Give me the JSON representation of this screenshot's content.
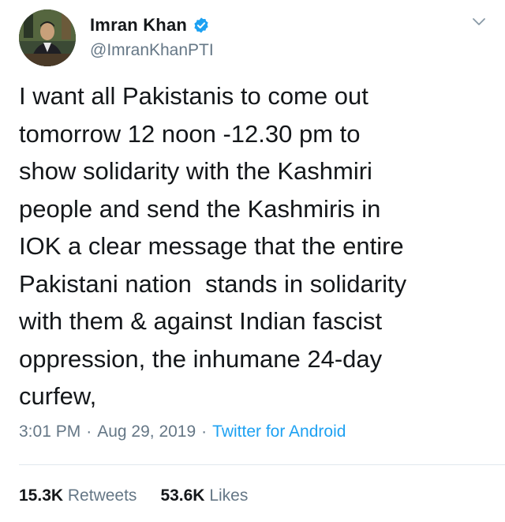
{
  "author": {
    "display_name": "Imran Khan",
    "handle": "@ImranKhanPTI",
    "verified_icon": "verified-badge-icon"
  },
  "tweet": {
    "text": "I want all Pakistanis to come out\ntomorrow 12 noon -12.30 pm to\nshow solidarity with the Kashmiri\npeople and send the Kashmiris in\nIOK a clear message that the entire\nPakistani nation  stands in solidarity\nwith them & against Indian fascist\noppression, the inhumane 24-day\ncurfew,",
    "time": "3:01 PM",
    "separator": "·",
    "date": "Aug 29, 2019",
    "source": "Twitter for Android"
  },
  "stats": {
    "retweets_count": "15.3K",
    "retweets_label": "Retweets",
    "likes_count": "53.6K",
    "likes_label": "Likes"
  },
  "colors": {
    "text": "#14171a",
    "secondary": "#657786",
    "accent": "#1da1f2",
    "divider": "#e1e8ed"
  }
}
